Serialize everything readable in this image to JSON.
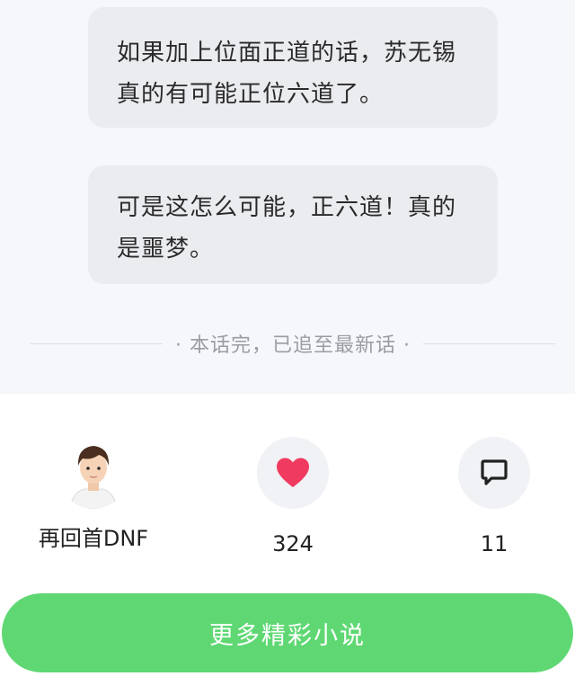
{
  "messages": [
    {
      "text": "如果加上位面正道的话，苏无锡真的有可能正位六道了。"
    },
    {
      "text": "可是这怎么可能，正六道！真的是噩梦。"
    }
  ],
  "chapter_end_text": "· 本话完，已追至最新话 ·",
  "author": {
    "name": "再回首DNF",
    "avatar_icon": "avatar-icon"
  },
  "like": {
    "count": "324",
    "icon": "heart-icon",
    "color": "#f03a5f"
  },
  "comment": {
    "count": "11",
    "icon": "comment-icon"
  },
  "more_button": {
    "label": "更多精彩小说",
    "color": "#5fd873"
  }
}
